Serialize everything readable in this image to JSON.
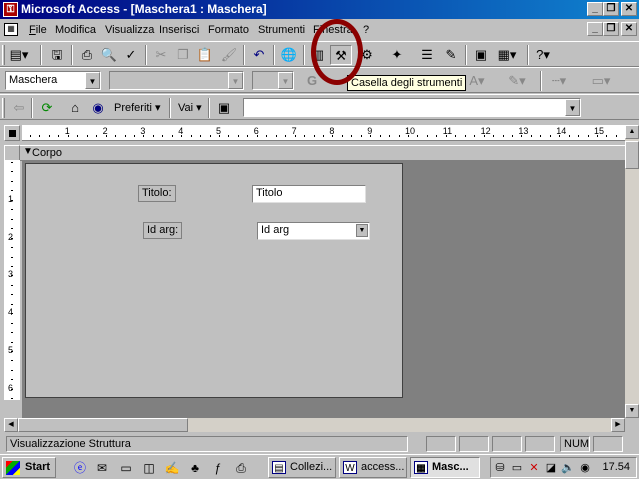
{
  "window": {
    "title": "Microsoft Access - [Maschera1 : Maschera]",
    "min": "_",
    "restore": "❐",
    "close": "✕"
  },
  "menu": {
    "items": [
      "File",
      "Modifica",
      "Visualizza",
      "Inserisci",
      "Formato",
      "Strumenti",
      "Finestra",
      "?"
    ],
    "underlined": [
      "F",
      "M",
      "V",
      "I",
      "o",
      "S",
      "n",
      "?"
    ]
  },
  "toolbar_format": {
    "object_combo": "Maschera",
    "font_combo": "",
    "size_combo": ""
  },
  "toolbar_web": {
    "favorites_label": "Preferiti",
    "go_label": "Vai",
    "address": ""
  },
  "tooltip": "Casella degli strumenti",
  "ruler": {
    "h_numbers": [
      "1",
      "2",
      "3",
      "4",
      "5",
      "6",
      "7",
      "8",
      "9",
      "10",
      "11",
      "12",
      "13",
      "14",
      "15"
    ],
    "v_numbers": [
      "1",
      "2",
      "3",
      "4",
      "5",
      "6"
    ]
  },
  "section": {
    "label": "Corpo"
  },
  "form": {
    "title_label": "Titolo:",
    "title_field": "Titolo",
    "arg_label": "Id arg:",
    "arg_field": "Id arg"
  },
  "status": {
    "mode": "Visualizzazione Struttura",
    "num": "NUM"
  },
  "taskbar": {
    "start": "Start",
    "tasks": [
      {
        "label": "Collezi...",
        "icon": "folder-icon"
      },
      {
        "label": "access...",
        "icon": "word-icon"
      },
      {
        "label": "Masc...",
        "icon": "form-icon"
      }
    ],
    "clock": "17.54"
  },
  "colors": {
    "title_active": "#000080",
    "workspace": "#808080",
    "form_bg": "#c0c0c0",
    "tooltip_bg": "#ffffe1",
    "highlight": "#8b0000"
  }
}
